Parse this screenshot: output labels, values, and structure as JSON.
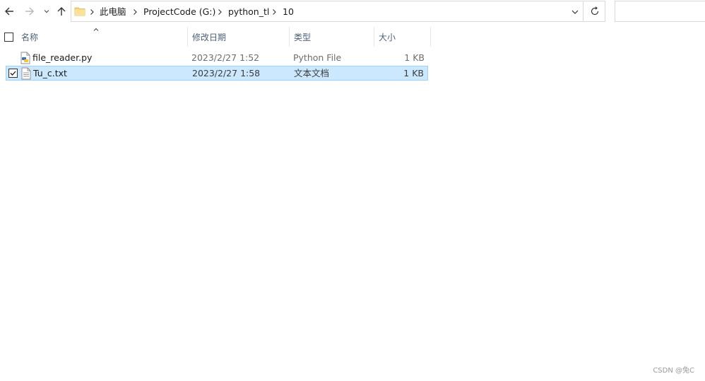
{
  "navigation": {
    "back_icon": "arrow-left-icon",
    "forward_icon": "arrow-right-icon",
    "recent_icon": "chevron-down-icon",
    "up_icon": "arrow-up-icon"
  },
  "address_bar": {
    "folder_icon": "folder-icon",
    "breadcrumbs": [
      "此电脑",
      "ProjectCode (G:)",
      "python_tl",
      "10"
    ],
    "dropdown_icon": "chevron-down-icon",
    "refresh_icon": "refresh-icon"
  },
  "search": {
    "value": ""
  },
  "columns": {
    "name": "名称",
    "date": "修改日期",
    "type": "类型",
    "size": "大小"
  },
  "files": [
    {
      "name": "file_reader.py",
      "date": "2023/2/27 1:52",
      "type": "Python File",
      "size": "1 KB",
      "icon": "python-file-icon",
      "selected": false
    },
    {
      "name": "Tu_c.txt",
      "date": "2023/2/27 1:58",
      "type": "文本文档",
      "size": "1 KB",
      "icon": "text-file-icon",
      "selected": true
    }
  ],
  "watermark": "CSDN @兔C",
  "colors": {
    "selection_bg": "#cce8ff",
    "selection_border": "#99d1ff",
    "header_text": "#4c607a",
    "folder_yellow": "#f8d775"
  }
}
